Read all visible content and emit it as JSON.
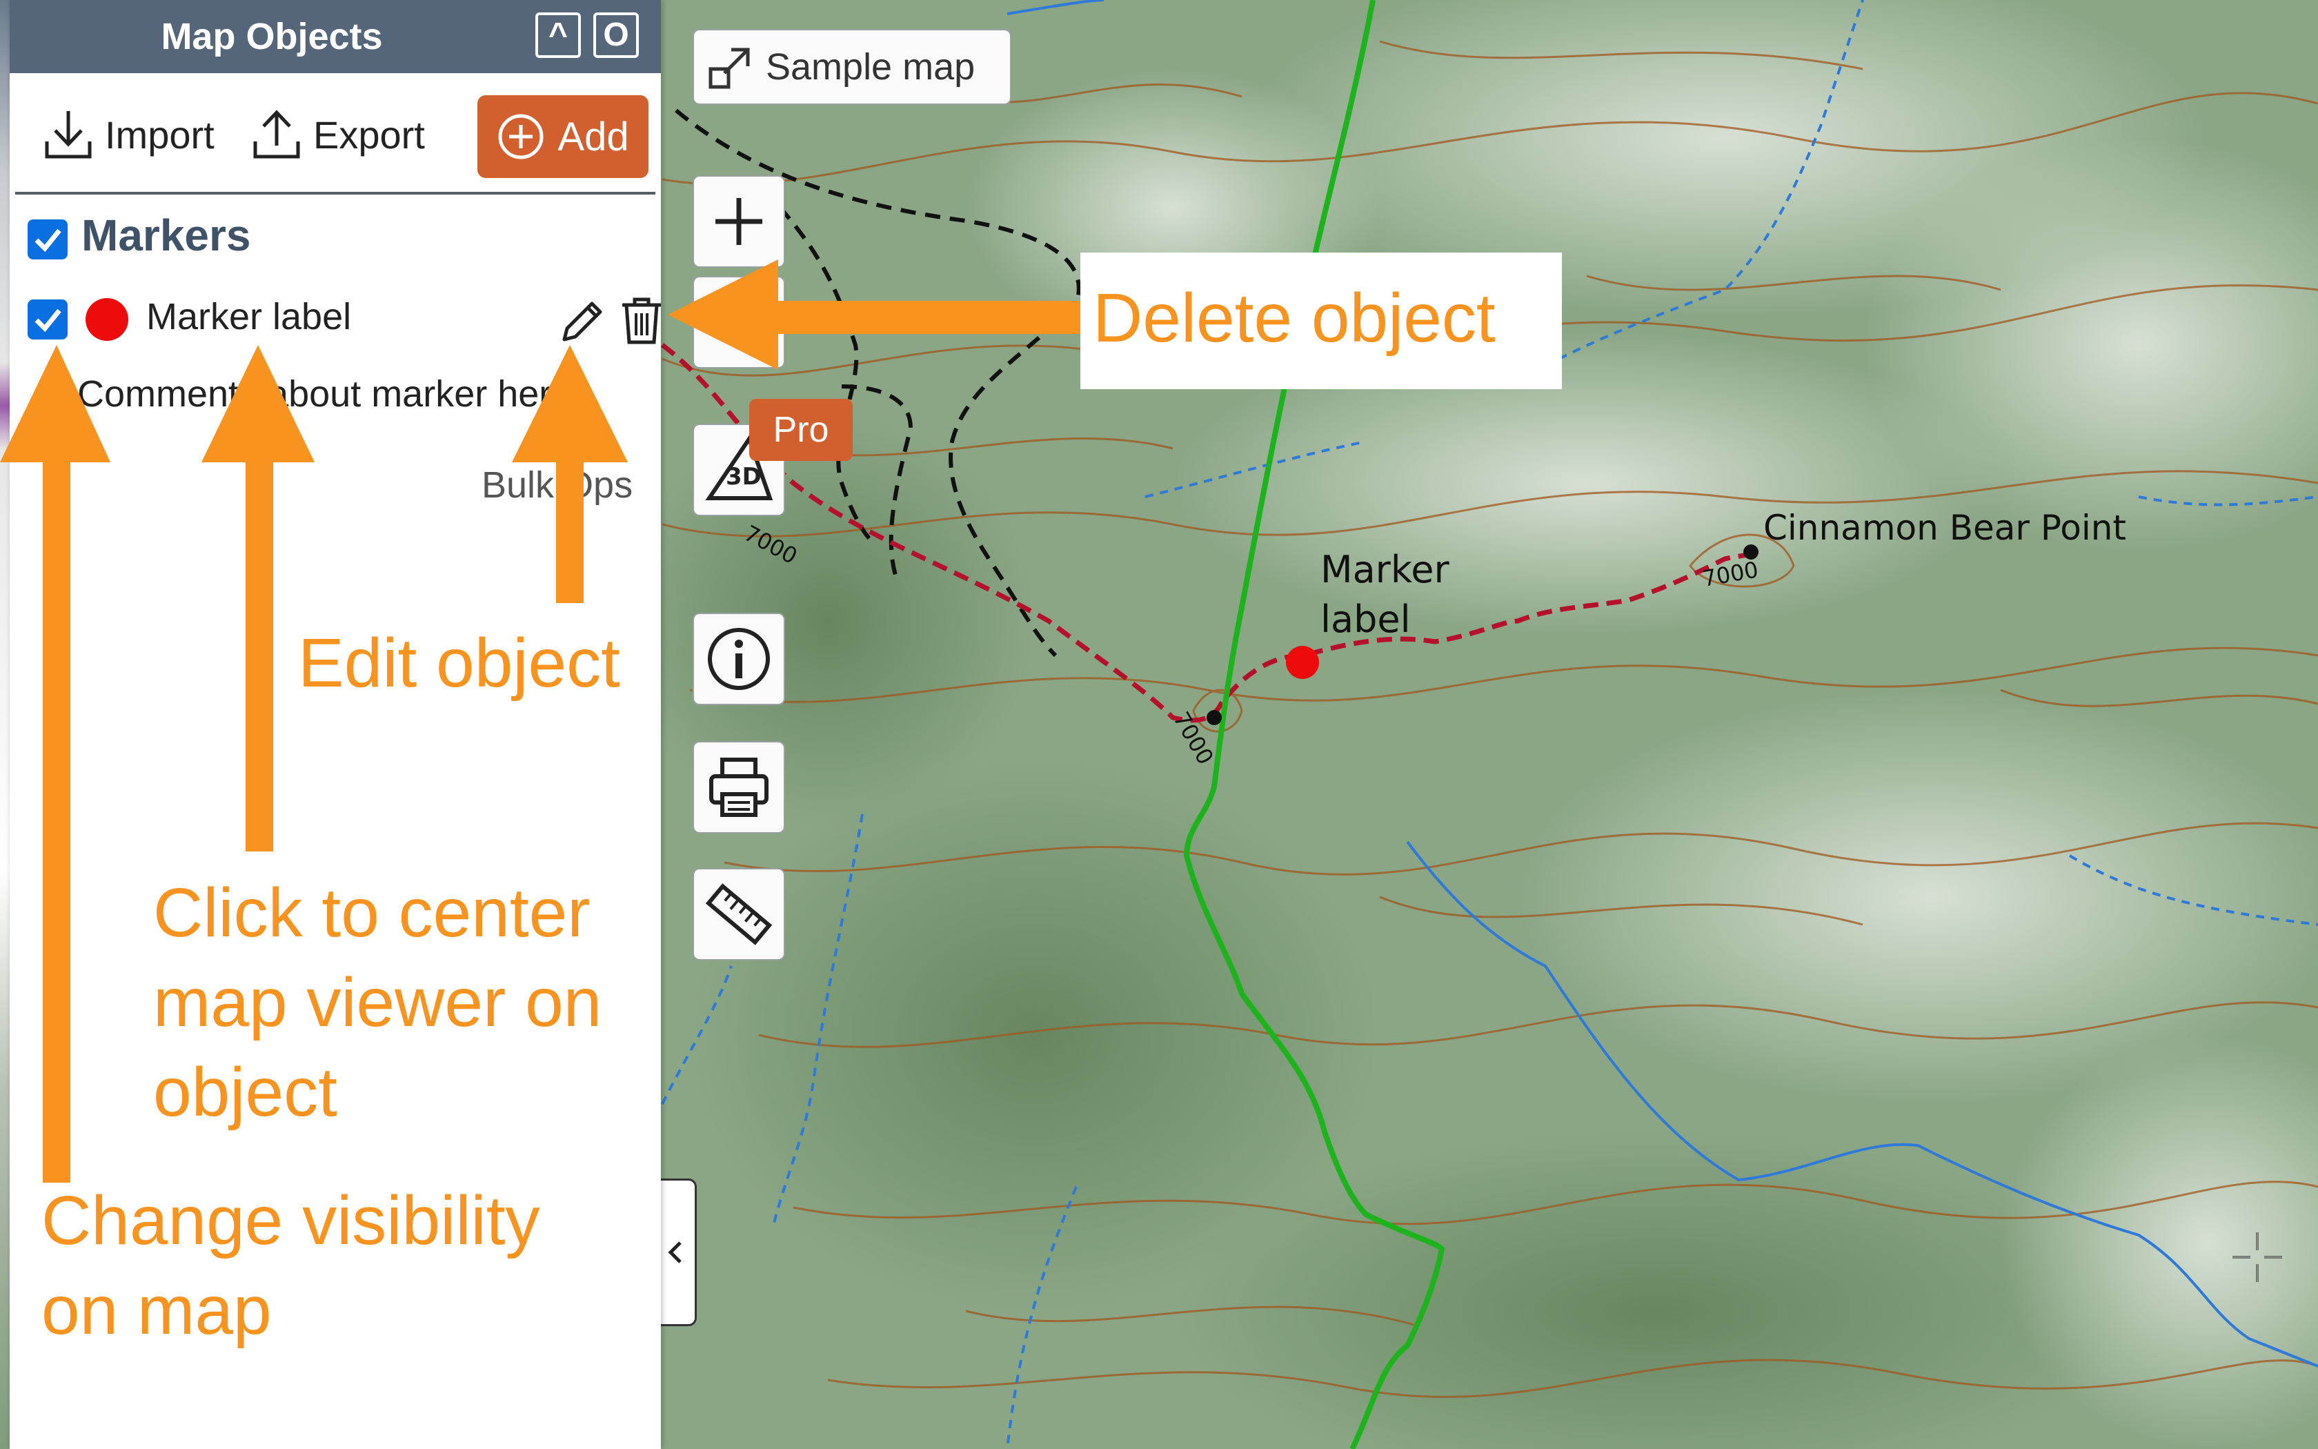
{
  "panel": {
    "title": "Map Objects",
    "collapse_label": "^",
    "expand_label": "O",
    "toolbar": {
      "import_label": "Import",
      "export_label": "Export",
      "add_label": "Add"
    },
    "group": {
      "title": "Markers",
      "checked": true
    },
    "marker": {
      "label": "Marker label",
      "color": "#ee0b0b",
      "checked": true,
      "comment": "Comments about marker here",
      "icons": [
        "pencil-icon",
        "trash-icon"
      ]
    },
    "bulk_ops_label": "Bulk Ops"
  },
  "map": {
    "sample_map_label": "Sample map",
    "pro_badge": "Pro",
    "view_3d_label": "3D",
    "controls": [
      "zoom-in",
      "zoom-out",
      "view-3d",
      "info",
      "print",
      "measure"
    ],
    "labels": {
      "peak": "Cinnamon Bear Point",
      "marker": "Marker label",
      "contour_7000": "7000"
    },
    "colors": {
      "trail_green": "#1db31d",
      "route_red": "#b5112c",
      "river_blue": "#2f7ad8",
      "contour_brown": "#a0571c"
    }
  },
  "annotations": {
    "delete": "Delete object",
    "edit": "Edit object",
    "center": "Click to center map viewer on object",
    "visibility": "Change visibility on map",
    "color": "#f7931e"
  },
  "colors": {
    "header": "#56667a",
    "accent": "#d2602f",
    "checkbox": "#0a6fe0"
  }
}
